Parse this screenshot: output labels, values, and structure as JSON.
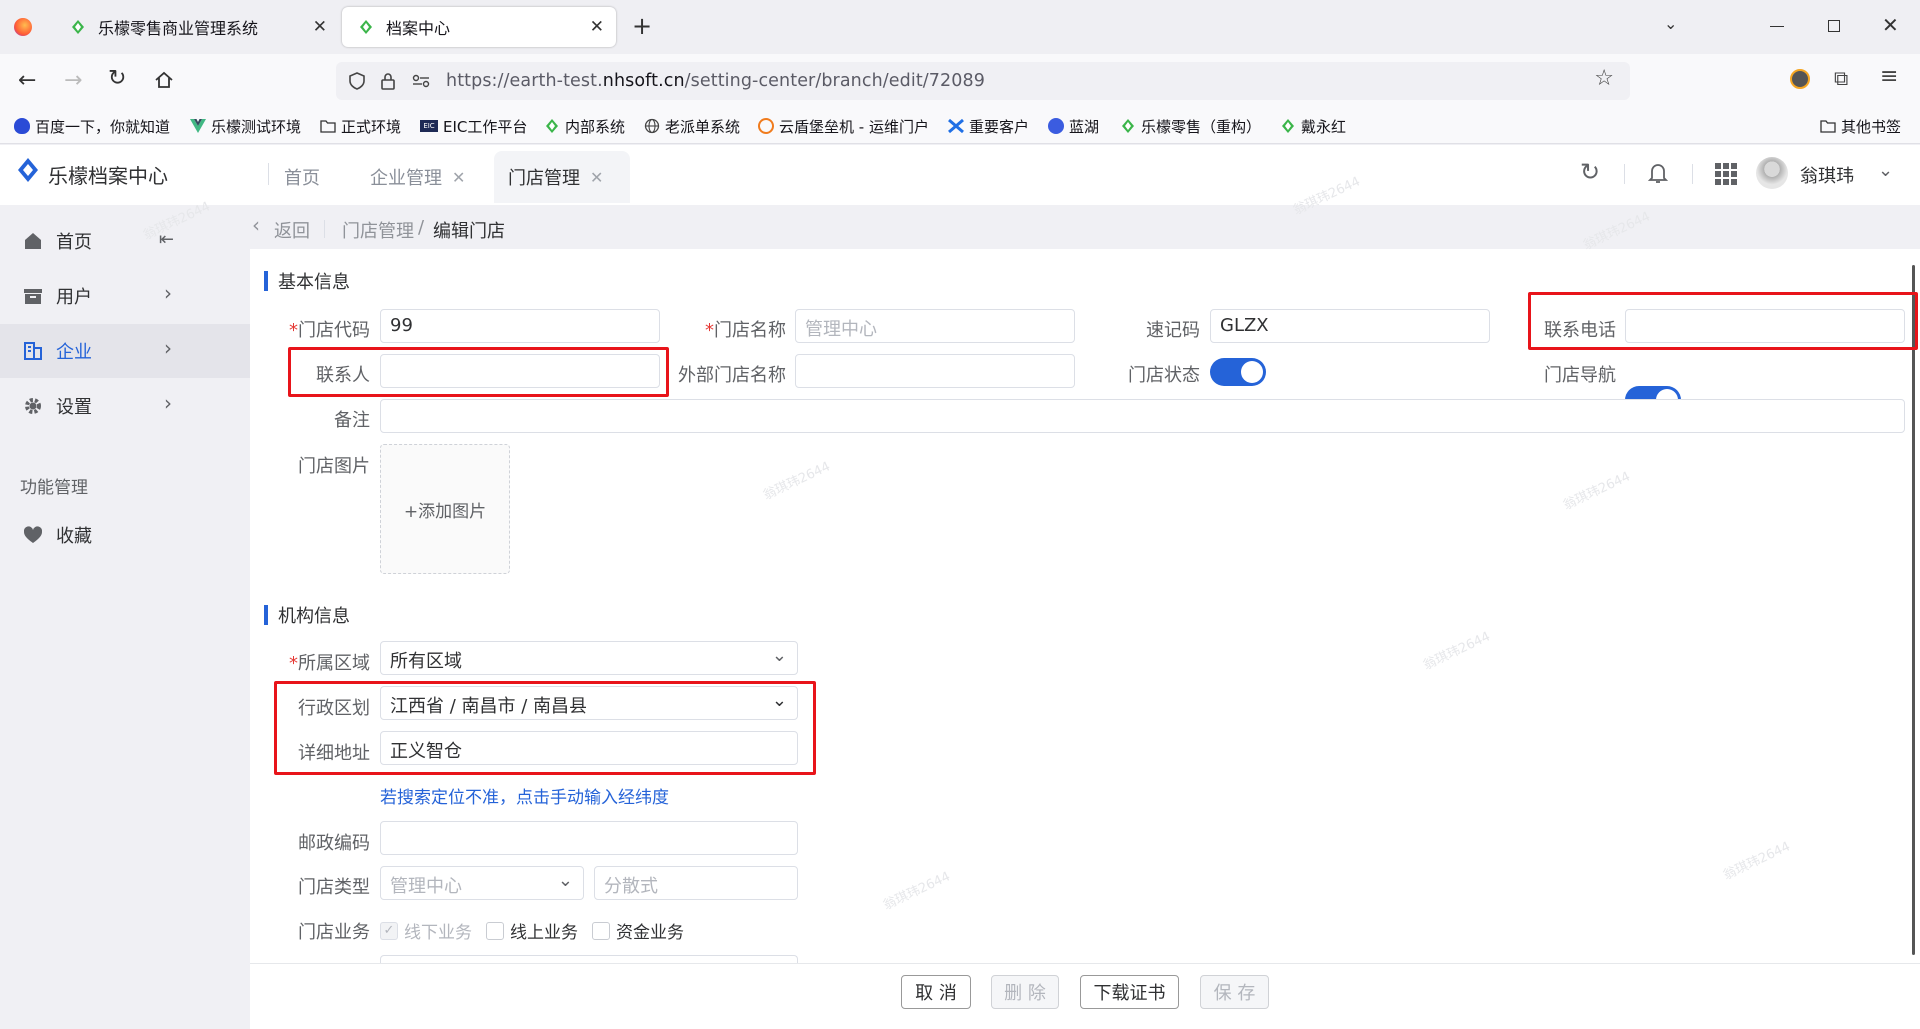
{
  "browser": {
    "tabs": [
      {
        "title": "乐檬零售商业管理系统"
      },
      {
        "title": "档案中心"
      }
    ],
    "url_prefix": "https://earth-test.",
    "url_domain": "nhsoft.cn",
    "url_suffix": "/setting-center/branch/edit/72089",
    "bookmarks": [
      "百度一下，你就知道",
      "乐檬测试环境",
      "正式环境",
      "EIC工作平台",
      "内部系统",
      "老派单系统",
      "云盾堡垒机 - 运维门户",
      "重要客户",
      "蓝湖",
      "乐檬零售（重构）",
      "戴永红"
    ],
    "other_bookmarks": "其他书签"
  },
  "app": {
    "logo_text": "乐檬档案中心",
    "tabs": [
      "首页",
      "企业管理",
      "门店管理"
    ],
    "user_name": "翁琪玮",
    "accent": "#2563d8"
  },
  "sidebar": {
    "items": [
      "首页",
      "用户",
      "企业",
      "设置"
    ],
    "group_title": "功能管理",
    "favorites": "收藏"
  },
  "breadcrumb": {
    "back": "返回",
    "parent": "门店管理",
    "sep": "/",
    "current": "编辑门店"
  },
  "basic": {
    "title": "基本信息",
    "store_code_label": "门店代码",
    "store_code": "99",
    "store_name_label": "门店名称",
    "store_name_placeholder": "管理中心",
    "shortcode_label": "速记码",
    "shortcode": "GLZX",
    "phone_label": "联系电话",
    "contact_label": "联系人",
    "external_name_label": "外部门店名称",
    "status_label": "门店状态",
    "status_on": true,
    "nav_label": "门店导航",
    "nav_on": true,
    "remark_label": "备注",
    "image_label": "门店图片",
    "add_image": "+添加图片"
  },
  "org": {
    "title": "机构信息",
    "region_label": "所属区域",
    "region": "所有区域",
    "admin_label": "行政区划",
    "admin": "江西省 / 南昌市 / 南昌县",
    "address_label": "详细地址",
    "address": "正义智仓",
    "manual_link": "若搜索定位不准，点击手动输入经纬度",
    "postcode_label": "邮政编码",
    "type_label": "门店类型",
    "type_placeholder": "管理中心",
    "type2_placeholder": "分散式",
    "business_label": "门店业务",
    "biz_offline": "线下业务",
    "biz_online": "线上业务",
    "biz_funds": "资金业务"
  },
  "actions": {
    "cancel": "取 消",
    "delete": "删 除",
    "download": "下载证书",
    "save": "保 存"
  },
  "watermark": "翁琪玮2644"
}
